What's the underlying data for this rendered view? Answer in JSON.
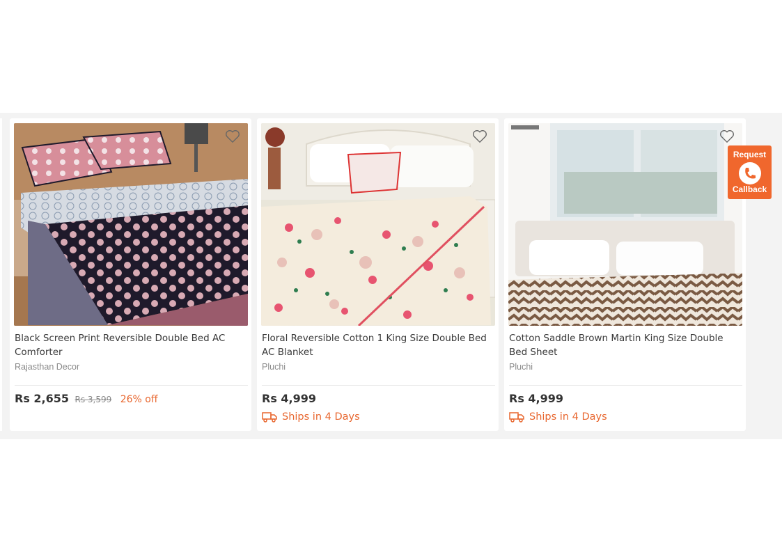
{
  "products": [
    {
      "title": "Black Screen Print Reversible Double Bed AC Comforter",
      "brand": "Rajasthan Decor",
      "price": "Rs 2,655",
      "mrp": "Rs 3,599",
      "discount": "26% off"
    },
    {
      "title": "Floral Reversible Cotton 1 King Size Double Bed AC Blanket",
      "brand": "Pluchi",
      "price": "Rs 4,999",
      "shipping": "Ships in 4 Days"
    },
    {
      "title": "Cotton Saddle Brown Martin King Size Double Bed Sheet",
      "brand": "Pluchi",
      "price": "Rs 4,999",
      "shipping": "Ships in 4 Days"
    }
  ],
  "callback": {
    "top_label": "Request",
    "bottom_label": "Callback"
  },
  "icons": {
    "wishlist": "heart-outline-icon",
    "shipping": "truck-icon",
    "callback": "phone-icon"
  },
  "colors": {
    "accent": "#e8662e",
    "callback_bg": "#f0672d",
    "strip_bg": "#f3f3f3"
  }
}
